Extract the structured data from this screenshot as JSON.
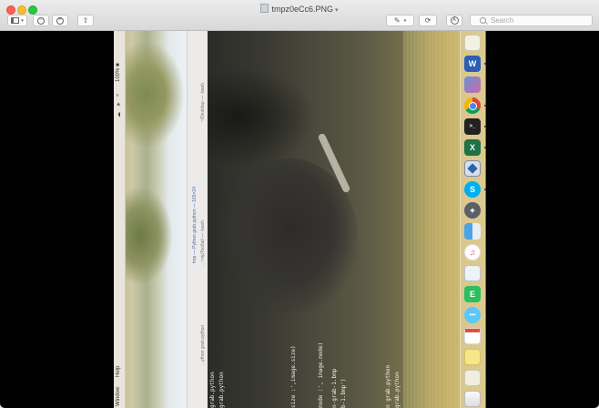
{
  "window": {
    "title": "tmpz0eCc6.PNG",
    "search_placeholder": "Search"
  },
  "menubar": {
    "status": "100% ■",
    "items": [
      "Window",
      "Help"
    ]
  },
  "terminal": {
    "tab_title": "tmp — Python grab.python — 165×24",
    "tab_left": "...ython grab.python",
    "tab_mid": "...~mpToc6ail — -bash",
    "tab_right": "~/Desktop — -bash",
    "lines": [
      "grab.python",
      "grab.python",
      "size :',image.size)",
      "mode :', image.mode)",
      "n-grab-1.bmp",
      "b-1.bmp')",
      "n grab.python",
      "grab.python"
    ]
  },
  "dock": {
    "icons": [
      "notes-icon",
      "word-icon",
      "photos-icon",
      "chrome-icon",
      "terminal-icon",
      "excel-icon",
      "virtualbox-icon",
      "skype-icon",
      "launchpad-icon",
      "finder-icon",
      "itunes-icon",
      "preview-icon",
      "evernote-icon",
      "messages-icon",
      "calendar-icon",
      "stickies-icon",
      "document-icon"
    ],
    "letters": {
      "word": "W",
      "excel": "X",
      "skype": "S",
      "evernote": "E"
    }
  }
}
